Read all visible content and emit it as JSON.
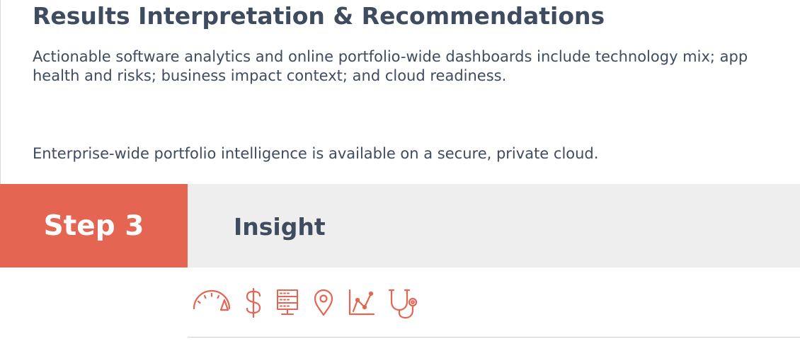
{
  "section": {
    "title": "Results Interpretation & Recommendations",
    "paragraphs": [
      "Actionable software analytics and online portfolio-wide dashboards include technology mix; app health and risks; business impact context; and cloud readiness.",
      "Enterprise-wide portfolio intelligence is available on a secure, private cloud."
    ]
  },
  "step": {
    "label": "Step 3",
    "name": "Insight"
  },
  "icons": [
    "speedometer-icon",
    "dollar-icon",
    "server-icon",
    "location-pin-icon",
    "line-chart-icon",
    "stethoscope-icon"
  ],
  "colors": {
    "accent": "#e56553",
    "heading": "#3f4b5e",
    "band": "#eeeeee"
  }
}
